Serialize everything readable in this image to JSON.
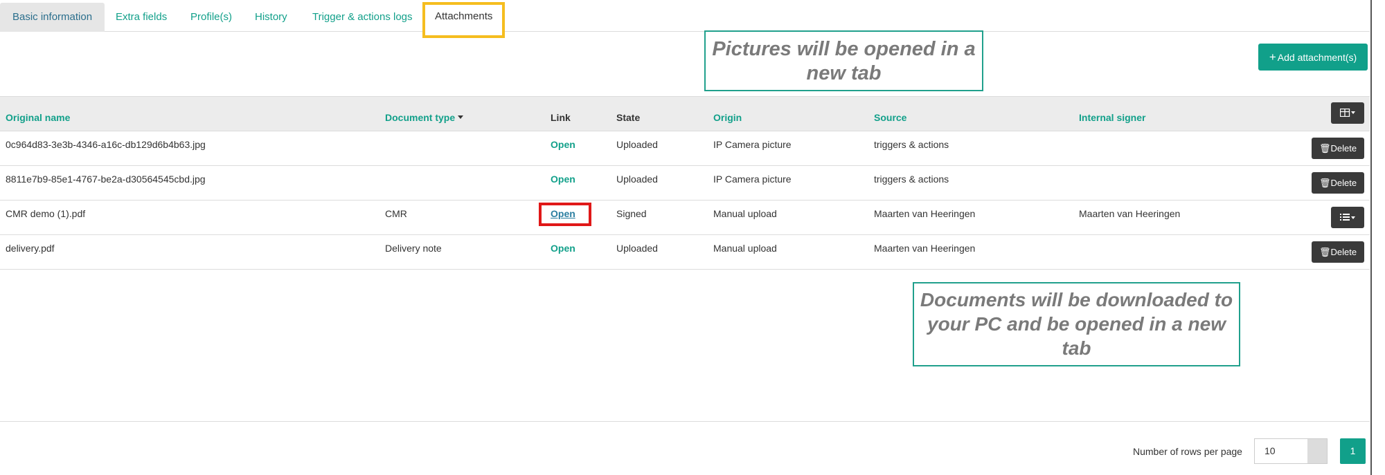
{
  "tabs": [
    {
      "label": "Basic information"
    },
    {
      "label": "Extra fields"
    },
    {
      "label": "Profile(s)"
    },
    {
      "label": "History"
    },
    {
      "label": "Trigger & actions logs"
    },
    {
      "label": "Attachments"
    }
  ],
  "callouts": {
    "pictures": "Pictures will be opened in a new tab",
    "documents": "Documents will be downloaded to your PC and be opened in a new tab"
  },
  "toolbar": {
    "add_label": "Add attachment(s)"
  },
  "table": {
    "headers": {
      "original_name": "Original name",
      "document_type": "Document type",
      "link": "Link",
      "state": "State",
      "origin": "Origin",
      "source": "Source",
      "internal_signer": "Internal signer"
    },
    "rows": [
      {
        "name": "0c964d83-3e3b-4346-a16c-db129d6b4b63.jpg",
        "doc_type": "",
        "link": "Open",
        "state": "Uploaded",
        "origin": "IP Camera picture",
        "source": "triggers & actions",
        "signer": "",
        "action": "Delete"
      },
      {
        "name": "8811e7b9-85e1-4767-be2a-d30564545cbd.jpg",
        "doc_type": "",
        "link": "Open",
        "state": "Uploaded",
        "origin": "IP Camera picture",
        "source": "triggers & actions",
        "signer": "",
        "action": "Delete"
      },
      {
        "name": "CMR demo (1).pdf",
        "doc_type": "CMR",
        "link": "Open",
        "state": "Signed",
        "origin": "Manual upload",
        "source": "Maarten van Heeringen",
        "signer": "Maarten van Heeringen",
        "action": ""
      },
      {
        "name": "delivery.pdf",
        "doc_type": "Delivery note",
        "link": "Open",
        "state": "Uploaded",
        "origin": "Manual upload",
        "source": "Maarten van Heeringen",
        "signer": "",
        "action": "Delete"
      }
    ]
  },
  "pagination": {
    "rows_label": "Number of rows per page",
    "rows_value": "10",
    "page": "1"
  },
  "colors": {
    "accent": "#11a08a",
    "tab_highlight": "#f5bd1f",
    "link_highlight": "#e01818",
    "button_dark": "#3a3a3a"
  },
  "icons": [
    "plus-icon",
    "table-columns-icon",
    "trash-icon",
    "list-menu-icon",
    "caret-down-icon"
  ]
}
